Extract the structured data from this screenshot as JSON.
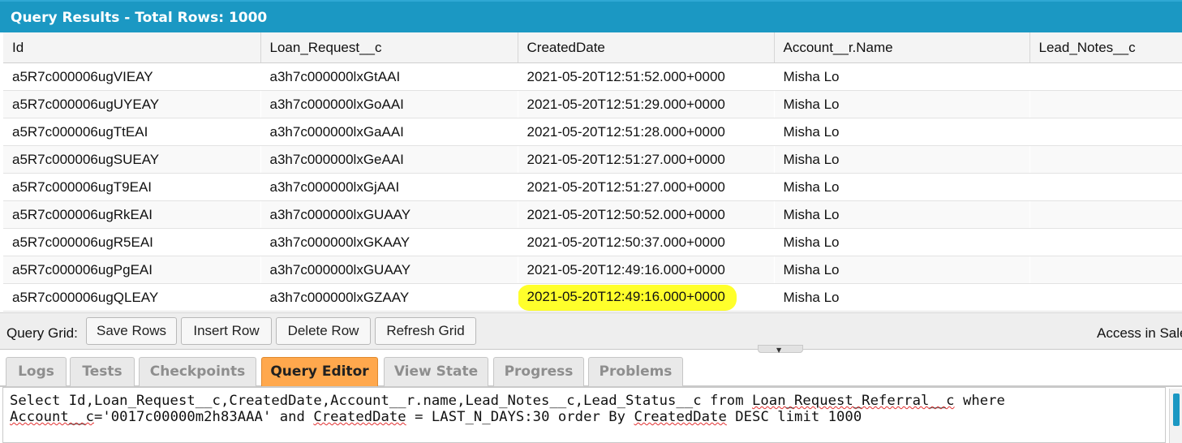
{
  "title": "Query Results - Total Rows: 1000",
  "columns": [
    "Id",
    "Loan_Request__c",
    "CreatedDate",
    "Account__r.Name",
    "Lead_Notes__c"
  ],
  "rows": [
    [
      "a5R7c000006ugVIEAY",
      "a3h7c000000lxGtAAI",
      "2021-05-20T12:51:52.000+0000",
      "Misha Lo",
      ""
    ],
    [
      "a5R7c000006ugUYEAY",
      "a3h7c000000lxGoAAI",
      "2021-05-20T12:51:29.000+0000",
      "Misha Lo",
      ""
    ],
    [
      "a5R7c000006ugTtEAI",
      "a3h7c000000lxGaAAI",
      "2021-05-20T12:51:28.000+0000",
      "Misha Lo",
      ""
    ],
    [
      "a5R7c000006ugSUEAY",
      "a3h7c000000lxGeAAI",
      "2021-05-20T12:51:27.000+0000",
      "Misha Lo",
      ""
    ],
    [
      "a5R7c000006ugT9EAI",
      "a3h7c000000lxGjAAI",
      "2021-05-20T12:51:27.000+0000",
      "Misha Lo",
      ""
    ],
    [
      "a5R7c000006ugRkEAI",
      "a3h7c000000lxGUAAY",
      "2021-05-20T12:50:52.000+0000",
      "Misha Lo",
      ""
    ],
    [
      "a5R7c000006ugR5EAI",
      "a3h7c000000lxGKAAY",
      "2021-05-20T12:50:37.000+0000",
      "Misha Lo",
      ""
    ],
    [
      "a5R7c000006ugPgEAI",
      "a3h7c000000lxGUAAY",
      "2021-05-20T12:49:16.000+0000",
      "Misha Lo",
      ""
    ],
    [
      "a5R7c000006ugQLEAY",
      "a3h7c000000lxGZAAY",
      "2021-05-20T12:49:16.000+0000",
      "Misha Lo",
      ""
    ]
  ],
  "toolbar": {
    "label": "Query Grid:",
    "save_rows": "Save Rows",
    "insert_row": "Insert Row",
    "delete_row": "Delete Row",
    "refresh_grid": "Refresh Grid",
    "right_text": "Access in Sale"
  },
  "splitter_glyph": "▼",
  "tabs": [
    "Logs",
    "Tests",
    "Checkpoints",
    "Query Editor",
    "View State",
    "Progress",
    "Problems"
  ],
  "active_tab": "Query Editor",
  "editor": {
    "line1_a": "Select Id,Loan_Request__c,CreatedDate,Account__r.name,Lead_Notes__c,Lead_Status__c from ",
    "line1_b": "Loan_Request_Referral__c",
    "line1_c": " where",
    "line2_a": "Account__c",
    "line2_b": "='0017c00000m2h83AAA' and ",
    "line2_c": "CreatedDate",
    "line2_d": " = LAST_N_DAYS:30 order By ",
    "line2_e": "CreatedDate",
    "line2_f": " DESC limit 1000"
  },
  "colors": {
    "header": "#1b98c3",
    "active_tab": "#ffa84d",
    "highlight": "#ffff2b"
  }
}
